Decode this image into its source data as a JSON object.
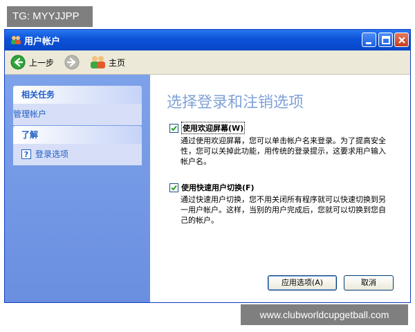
{
  "watermarks": {
    "top": "TG: MYYJJPP",
    "bottom": "www.clubworldcupgetball.com"
  },
  "window": {
    "title": "用户帐户"
  },
  "toolbar": {
    "back_label": "上一步",
    "home_label": "主页"
  },
  "sidebar": {
    "related_tasks": {
      "title": "相关任务",
      "items": [
        "管理帐户"
      ]
    },
    "learn": {
      "title": "了解",
      "items": [
        "登录选项"
      ]
    }
  },
  "main": {
    "heading": "选择登录和注销选项",
    "options": [
      {
        "label": "使用欢迎屏幕(W)",
        "checked": true,
        "desc": "通过使用欢迎屏幕，您可以单击帐户名来登录。为了提高安全性，您可以关掉此功能，用传统的登录提示，这要求用户输入帐户名。"
      },
      {
        "label": "使用快速用户切换(F)",
        "checked": true,
        "desc": "通过快速用户切换，您不用关闭所有程序就可以快速切换到另一用户帐户。这样，当别的用户完成后，您就可以切换到您自己的帐户。"
      }
    ],
    "apply_label": "应用选项(A)",
    "cancel_label": "取消"
  },
  "colors": {
    "title_bar": "#0b52d8",
    "sidebar": "#7da2ea",
    "heading": "#7fa2d8",
    "link": "#215dc6"
  }
}
